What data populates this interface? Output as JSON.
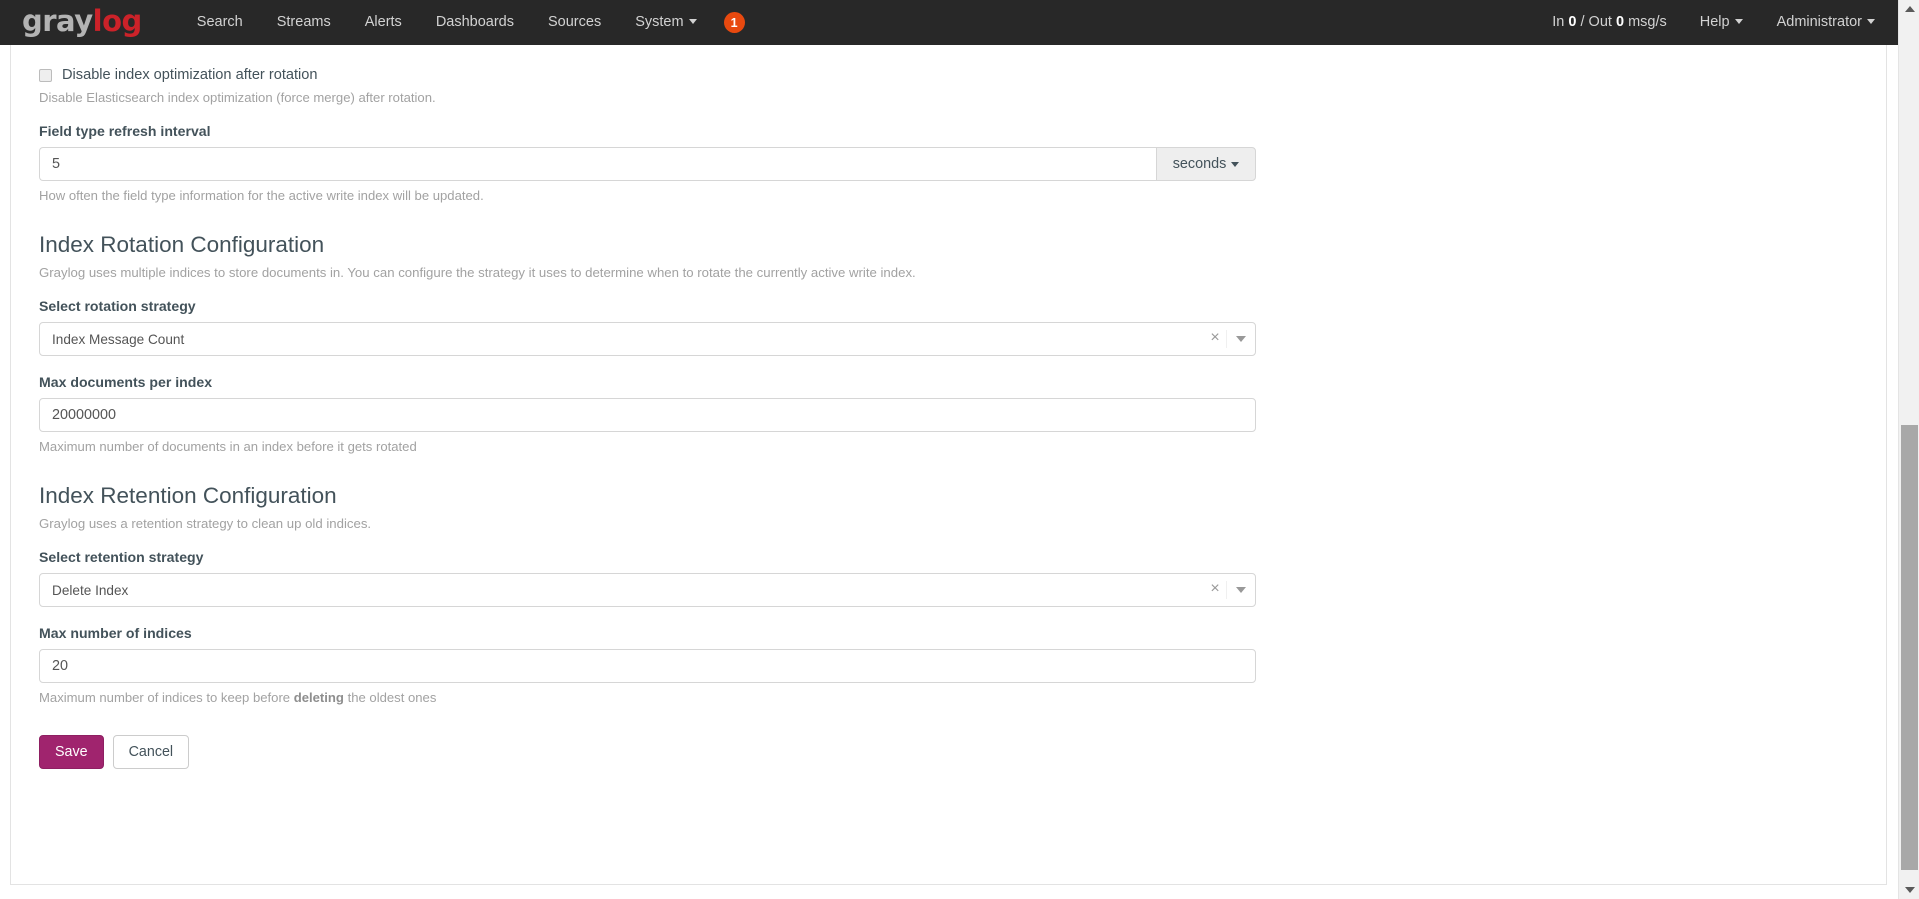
{
  "navbar": {
    "brand": {
      "part1": "gray",
      "part2": "log",
      "icon": "graylog-logo"
    },
    "links": [
      {
        "label": "Search",
        "name": "nav-link-search"
      },
      {
        "label": "Streams",
        "name": "nav-link-streams"
      },
      {
        "label": "Alerts",
        "name": "nav-link-alerts"
      },
      {
        "label": "Dashboards",
        "name": "nav-link-dashboards"
      },
      {
        "label": "Sources",
        "name": "nav-link-sources"
      },
      {
        "label": "System",
        "name": "nav-link-system",
        "has_caret": true
      }
    ],
    "notification_badge": "1",
    "throughput": {
      "prefix": "In ",
      "in": "0",
      "middle": " / Out ",
      "out": "0",
      "suffix": " msg/s"
    },
    "help": "Help",
    "user": "Administrator"
  },
  "form": {
    "disable_optimization": {
      "label": "Disable index optimization after rotation",
      "help": "Disable Elasticsearch index optimization (force merge) after rotation.",
      "checked": false
    },
    "field_type_refresh": {
      "label": "Field type refresh interval",
      "value": "5",
      "unit": "seconds",
      "help": "How often the field type information for the active write index will be updated."
    }
  },
  "rotation_section": {
    "title": "Index Rotation Configuration",
    "description": "Graylog uses multiple indices to store documents in. You can configure the strategy it uses to determine when to rotate the currently active write index.",
    "strategy_label": "Select rotation strategy",
    "strategy_value": "Index Message Count",
    "max_docs_label": "Max documents per index",
    "max_docs_value": "20000000",
    "max_docs_help": "Maximum number of documents in an index before it gets rotated"
  },
  "retention_section": {
    "title": "Index Retention Configuration",
    "description": "Graylog uses a retention strategy to clean up old indices.",
    "strategy_label": "Select retention strategy",
    "strategy_value": "Delete Index",
    "max_indices_label": "Max number of indices",
    "max_indices_value": "20",
    "max_indices_help_pre": "Maximum number of indices to keep before ",
    "max_indices_help_bold": "deleting",
    "max_indices_help_post": " the oldest ones"
  },
  "actions": {
    "save": "Save",
    "cancel": "Cancel"
  },
  "colors": {
    "navbar_bg": "#282828",
    "brand_gray": "#b3b3b3",
    "brand_red": "#cc2229",
    "badge": "#e8490f",
    "primary": "#a0246e",
    "text": "#43525a",
    "help_text": "#a2a2a2"
  },
  "scrollbar": {
    "up_icon": "triangle-up-icon",
    "down_icon": "triangle-down-icon"
  }
}
